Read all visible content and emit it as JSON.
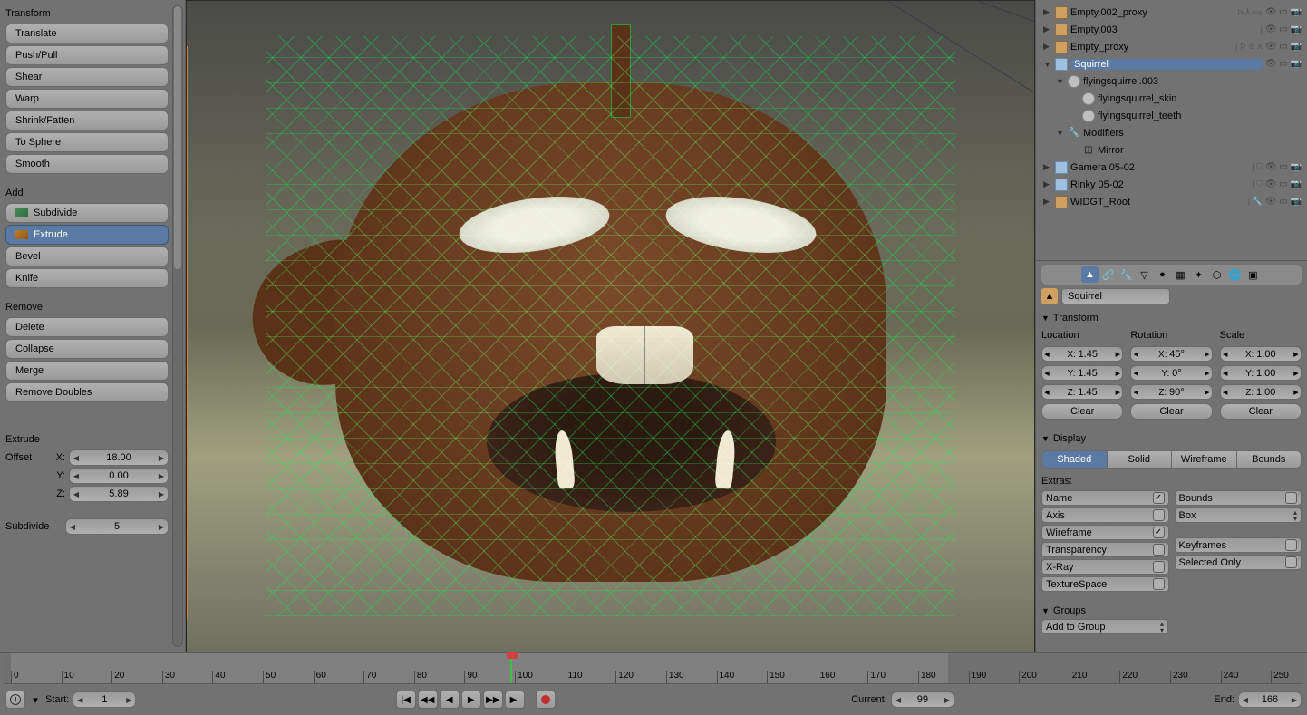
{
  "left_panel": {
    "transform_header": "Transform",
    "transform_tools": [
      "Translate",
      "Push/Pull",
      "Shear",
      "Warp",
      "Shrink/Fatten",
      "To Sphere",
      "Smooth"
    ],
    "add_header": "Add",
    "add_tools": [
      "Subdivide",
      "Extrude",
      "Bevel",
      "Knife"
    ],
    "add_active_index": 1,
    "remove_header": "Remove",
    "remove_tools": [
      "Delete",
      "Collapse",
      "Merge",
      "Remove Doubles"
    ],
    "extrude_header": "Extrude",
    "offset_label": "Offset",
    "offset": {
      "x": "18.00",
      "y": "0.00",
      "z": "5.89"
    },
    "subdivide_label": "Subdivide",
    "subdivide_value": "5"
  },
  "outliner": [
    {
      "indent": 0,
      "expand": "▶",
      "icon": "cube",
      "name": "Empty.002_proxy",
      "mini": "| ᐅ人፨ጰ",
      "toggles": "👁 ▭ 📷"
    },
    {
      "indent": 0,
      "expand": "▶",
      "icon": "cube",
      "name": "Empty.003",
      "mini": "|",
      "toggles": "👁 ▭ 📷"
    },
    {
      "indent": 0,
      "expand": "▶",
      "icon": "cube",
      "name": "Empty_proxy",
      "mini": "| ᐅ ⊛ ጰ",
      "toggles": "👁 ▭ 📷"
    },
    {
      "indent": 0,
      "expand": "▼",
      "icon": "arm",
      "name": "Squirrel",
      "selected": true,
      "toggles": "👁 ▭ 📷"
    },
    {
      "indent": 1,
      "expand": "▼",
      "icon": "mesh",
      "name": "flyingsquirrel.003"
    },
    {
      "indent": 2,
      "expand": "",
      "icon": "sphere",
      "name": "flyingsquirrel_skin"
    },
    {
      "indent": 2,
      "expand": "",
      "icon": "sphere",
      "name": "flyingsquirrel_teeth"
    },
    {
      "indent": 1,
      "expand": "▼",
      "icon": "wrench",
      "name": "Modifiers"
    },
    {
      "indent": 2,
      "expand": "",
      "icon": "mirror",
      "name": "Mirror"
    },
    {
      "indent": 0,
      "expand": "▶",
      "icon": "arm",
      "name": "Gamera 05-02",
      "mini": "| ⛉",
      "toggles": "👁 ▭ 📷"
    },
    {
      "indent": 0,
      "expand": "▶",
      "icon": "arm",
      "name": "Rinky 05-02",
      "mini": "| ⛉",
      "toggles": "👁 ▭ 📷"
    },
    {
      "indent": 0,
      "expand": "▶",
      "icon": "cube",
      "name": "WIDGT_Root",
      "mini": "| 🔧",
      "toggles": "👁 ▭ 📷"
    }
  ],
  "properties": {
    "datablock_name": "Squirrel",
    "transform_header": "Transform",
    "location_label": "Location",
    "rotation_label": "Rotation",
    "scale_label": "Scale",
    "location": {
      "x": "1.45",
      "y": "1.45",
      "z": "1.45"
    },
    "rotation": {
      "x": "45°",
      "y": "0°",
      "z": "90°"
    },
    "scale": {
      "x": "1.00",
      "y": "1.00",
      "z": "1.00"
    },
    "clear_label": "Clear",
    "display_header": "Display",
    "shading_modes": [
      "Shaded",
      "Solid",
      "Wireframe",
      "Bounds"
    ],
    "shading_active_index": 0,
    "extras_label": "Extras:",
    "extras_left": [
      {
        "label": "Name",
        "checked": true
      },
      {
        "label": "Axis",
        "checked": false
      },
      {
        "label": "Wireframe",
        "checked": true
      },
      {
        "label": "Transparency",
        "checked": false
      },
      {
        "label": "X-Ray",
        "checked": false
      },
      {
        "label": "TextureSpace",
        "checked": false
      }
    ],
    "extras_right": [
      {
        "type": "check",
        "label": "Bounds",
        "checked": false
      },
      {
        "type": "dropdown",
        "label": "Box"
      },
      {
        "type": "gap"
      },
      {
        "type": "check",
        "label": "Keyframes",
        "checked": false
      },
      {
        "type": "check",
        "label": "Selected Only",
        "checked": false
      }
    ],
    "groups_header": "Groups",
    "add_to_group": "Add to Group"
  },
  "timeline": {
    "ticks": [
      0,
      10,
      20,
      30,
      40,
      50,
      60,
      70,
      80,
      90,
      100,
      110,
      120,
      130,
      140,
      150,
      160,
      170,
      180,
      190,
      200,
      210,
      220,
      230,
      240,
      250
    ],
    "playhead_frame": 99,
    "start_label": "Start:",
    "start_value": "1",
    "current_label": "Current:",
    "current_value": "99",
    "end_label": "End:",
    "end_value": "166"
  }
}
